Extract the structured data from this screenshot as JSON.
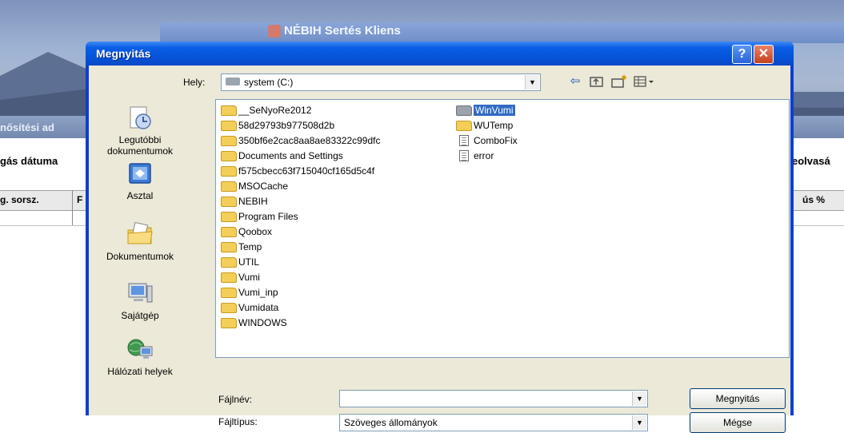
{
  "background_app": {
    "title": "NÉBIH Sertés Kliens",
    "panel_label": "nősítési ad",
    "column_left": "gás dátuma",
    "column_right": "eolvasá",
    "grid_col1": "g. sorsz.",
    "grid_col2": "F",
    "grid_col3": "ús %"
  },
  "dialog": {
    "title": "Megnyitás",
    "help_label": "?",
    "close_label": "✕",
    "look_in_label": "Hely:",
    "look_in_value": "system (C:)",
    "toolbar_icons": [
      "back-arrow-icon",
      "up-folder-icon",
      "new-folder-icon",
      "views-menu-icon"
    ],
    "places": [
      {
        "label": "Legutóbbi dokumentumok",
        "icon": "recent-documents-icon"
      },
      {
        "label": "Asztal",
        "icon": "desktop-icon"
      },
      {
        "label": "Dokumentumok",
        "icon": "my-documents-icon"
      },
      {
        "label": "Sajátgép",
        "icon": "my-computer-icon"
      },
      {
        "label": "Hálózati helyek",
        "icon": "network-places-icon"
      }
    ],
    "files_col1": [
      {
        "name": "__SeNyoRe2012",
        "type": "folder"
      },
      {
        "name": "58d29793b977508d2b",
        "type": "folder"
      },
      {
        "name": "350bf6e2cac8aa8ae83322c99dfc",
        "type": "folder"
      },
      {
        "name": "Documents and Settings",
        "type": "folder"
      },
      {
        "name": "f575cbecc63f715040cf165d5c4f",
        "type": "folder"
      },
      {
        "name": "MSOCache",
        "type": "folder"
      },
      {
        "name": "NEBIH",
        "type": "folder"
      },
      {
        "name": "Program Files",
        "type": "folder"
      },
      {
        "name": "Qoobox",
        "type": "folder"
      },
      {
        "name": "Temp",
        "type": "folder"
      },
      {
        "name": "UTIL",
        "type": "folder"
      },
      {
        "name": "Vumi",
        "type": "folder"
      },
      {
        "name": "Vumi_inp",
        "type": "folder"
      },
      {
        "name": "Vumidata",
        "type": "folder"
      },
      {
        "name": "WINDOWS",
        "type": "folder"
      }
    ],
    "files_col2": [
      {
        "name": "WinVumi",
        "type": "folder-grey",
        "selected": true
      },
      {
        "name": "WUTemp",
        "type": "folder"
      },
      {
        "name": "ComboFix",
        "type": "file"
      },
      {
        "name": "error",
        "type": "file"
      }
    ],
    "file_name_label": "Fájlnév:",
    "file_name_value": "",
    "file_type_label": "Fájltípus:",
    "file_type_value": "Szöveges állományok",
    "open_button": "Megnyitás",
    "cancel_button": "Mégse"
  }
}
